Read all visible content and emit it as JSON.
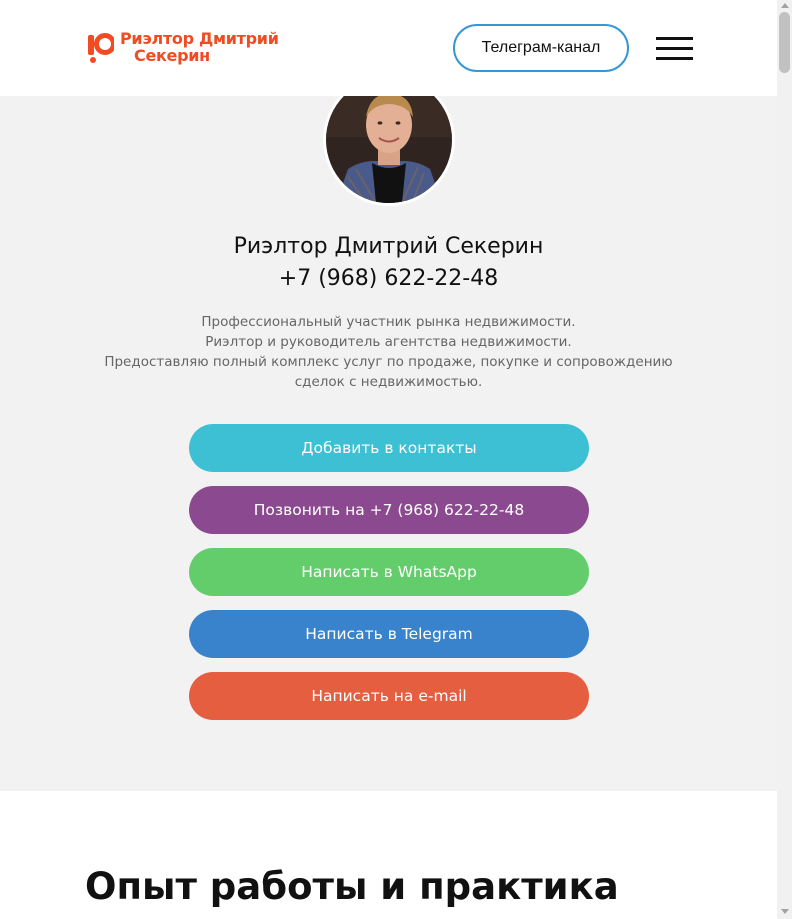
{
  "header": {
    "logo_line1": "Риэлтор Дмитрий",
    "logo_line2": "Секерин",
    "telegram_button": "Телеграм-канал",
    "menu_icon": "hamburger-menu-icon"
  },
  "profile": {
    "name": "Риэлтор Дмитрий Секерин",
    "phone": "+7 (968) 622-22-48",
    "description_line1": "Профессиональный участник рынка недвижимости.",
    "description_line2": "Риэлтор и руководитель агентства недвижимости.",
    "description_line3": "Предоставляю полный комплекс услуг по продаже, покупке и сопровождению сделок с недвижимостью."
  },
  "actions": {
    "add_contact": "Добавить в контакты",
    "call": "Позвонить на +7 (968) 622-22-48",
    "whatsapp": "Написать в WhatsApp",
    "telegram": "Написать в Telegram",
    "email": "Написать на e-mail"
  },
  "colors": {
    "brand": "#f24b23",
    "add_contact": "#3ec0d4",
    "call": "#8b4a8f",
    "whatsapp": "#64cd6b",
    "telegram": "#3983cc",
    "email": "#e45e3f"
  },
  "experience": {
    "title": "Опыт работы и практика"
  }
}
